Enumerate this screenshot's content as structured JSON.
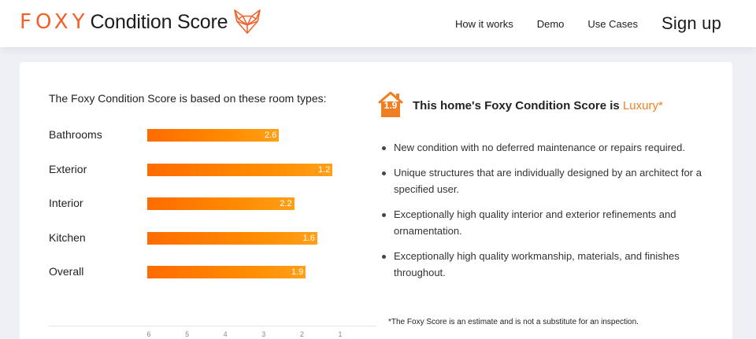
{
  "header": {
    "logo_foxy": "FOXY",
    "logo_cs": "Condition Score",
    "logo_icon": "fox-head-icon",
    "nav": [
      {
        "label": "How it works"
      },
      {
        "label": "Demo"
      },
      {
        "label": "Use Cases"
      }
    ],
    "signup": "Sign up"
  },
  "chart_data": {
    "type": "bar",
    "title": "The Foxy Condition Score is based on these room types:",
    "categories": [
      "Bathrooms",
      "Exterior",
      "Interior",
      "Kitchen",
      "Overall"
    ],
    "values": [
      2.6,
      1.2,
      2.2,
      1.6,
      1.9
    ],
    "value_labels": [
      "2.6",
      "1.2",
      "2.2",
      "1.6",
      "1.9"
    ],
    "xlim": [
      6,
      1
    ],
    "x_ticks": [
      "6",
      "5",
      "4",
      "3",
      "2",
      "1"
    ],
    "orientation": "horizontal",
    "reversed_axis": true,
    "bar_color": "#ff7a00",
    "grid": false
  },
  "score": {
    "value": "1.9",
    "title_prefix": "This home's Foxy Condition Score is ",
    "tier": "Luxury",
    "tier_suffix": "*",
    "house_icon": "house-icon",
    "accent": "#f07f23"
  },
  "bullets": [
    "New condition with no deferred maintenance or repairs required.",
    "Unique structures that are individually designed by an architect for a specified user.",
    "Exceptionally high quality interior and exterior refinements and ornamentation.",
    "Exceptionally high quality workmanship, materials, and finishes throughout."
  ],
  "disclaimer": "*The Foxy Score is an estimate and is not a substitute for an inspection."
}
